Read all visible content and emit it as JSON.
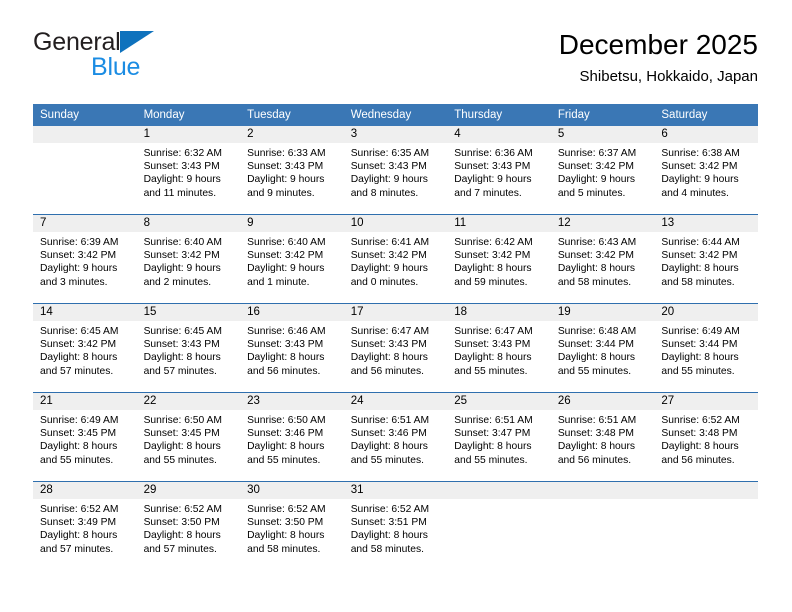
{
  "brand": {
    "name_part1": "General",
    "name_part2": "Blue",
    "triangle_color": "#0f72bd",
    "blue_text_color": "#1b8ce3"
  },
  "header": {
    "title": "December 2025",
    "subtitle": "Shibetsu, Hokkaido, Japan"
  },
  "theme": {
    "header_bg": "#3a77b5",
    "row_line": "#2f6fae",
    "daynum_band": "#efefef"
  },
  "calendar": {
    "weekday_headers": [
      "Sunday",
      "Monday",
      "Tuesday",
      "Wednesday",
      "Thursday",
      "Friday",
      "Saturday"
    ],
    "weeks": [
      [
        {
          "day": "",
          "sunrise": "",
          "sunset": "",
          "daylight_line1": "",
          "daylight_line2": ""
        },
        {
          "day": "1",
          "sunrise": "Sunrise: 6:32 AM",
          "sunset": "Sunset: 3:43 PM",
          "daylight_line1": "Daylight: 9 hours",
          "daylight_line2": "and 11 minutes."
        },
        {
          "day": "2",
          "sunrise": "Sunrise: 6:33 AM",
          "sunset": "Sunset: 3:43 PM",
          "daylight_line1": "Daylight: 9 hours",
          "daylight_line2": "and 9 minutes."
        },
        {
          "day": "3",
          "sunrise": "Sunrise: 6:35 AM",
          "sunset": "Sunset: 3:43 PM",
          "daylight_line1": "Daylight: 9 hours",
          "daylight_line2": "and 8 minutes."
        },
        {
          "day": "4",
          "sunrise": "Sunrise: 6:36 AM",
          "sunset": "Sunset: 3:43 PM",
          "daylight_line1": "Daylight: 9 hours",
          "daylight_line2": "and 7 minutes."
        },
        {
          "day": "5",
          "sunrise": "Sunrise: 6:37 AM",
          "sunset": "Sunset: 3:42 PM",
          "daylight_line1": "Daylight: 9 hours",
          "daylight_line2": "and 5 minutes."
        },
        {
          "day": "6",
          "sunrise": "Sunrise: 6:38 AM",
          "sunset": "Sunset: 3:42 PM",
          "daylight_line1": "Daylight: 9 hours",
          "daylight_line2": "and 4 minutes."
        }
      ],
      [
        {
          "day": "7",
          "sunrise": "Sunrise: 6:39 AM",
          "sunset": "Sunset: 3:42 PM",
          "daylight_line1": "Daylight: 9 hours",
          "daylight_line2": "and 3 minutes."
        },
        {
          "day": "8",
          "sunrise": "Sunrise: 6:40 AM",
          "sunset": "Sunset: 3:42 PM",
          "daylight_line1": "Daylight: 9 hours",
          "daylight_line2": "and 2 minutes."
        },
        {
          "day": "9",
          "sunrise": "Sunrise: 6:40 AM",
          "sunset": "Sunset: 3:42 PM",
          "daylight_line1": "Daylight: 9 hours",
          "daylight_line2": "and 1 minute."
        },
        {
          "day": "10",
          "sunrise": "Sunrise: 6:41 AM",
          "sunset": "Sunset: 3:42 PM",
          "daylight_line1": "Daylight: 9 hours",
          "daylight_line2": "and 0 minutes."
        },
        {
          "day": "11",
          "sunrise": "Sunrise: 6:42 AM",
          "sunset": "Sunset: 3:42 PM",
          "daylight_line1": "Daylight: 8 hours",
          "daylight_line2": "and 59 minutes."
        },
        {
          "day": "12",
          "sunrise": "Sunrise: 6:43 AM",
          "sunset": "Sunset: 3:42 PM",
          "daylight_line1": "Daylight: 8 hours",
          "daylight_line2": "and 58 minutes."
        },
        {
          "day": "13",
          "sunrise": "Sunrise: 6:44 AM",
          "sunset": "Sunset: 3:42 PM",
          "daylight_line1": "Daylight: 8 hours",
          "daylight_line2": "and 58 minutes."
        }
      ],
      [
        {
          "day": "14",
          "sunrise": "Sunrise: 6:45 AM",
          "sunset": "Sunset: 3:42 PM",
          "daylight_line1": "Daylight: 8 hours",
          "daylight_line2": "and 57 minutes."
        },
        {
          "day": "15",
          "sunrise": "Sunrise: 6:45 AM",
          "sunset": "Sunset: 3:43 PM",
          "daylight_line1": "Daylight: 8 hours",
          "daylight_line2": "and 57 minutes."
        },
        {
          "day": "16",
          "sunrise": "Sunrise: 6:46 AM",
          "sunset": "Sunset: 3:43 PM",
          "daylight_line1": "Daylight: 8 hours",
          "daylight_line2": "and 56 minutes."
        },
        {
          "day": "17",
          "sunrise": "Sunrise: 6:47 AM",
          "sunset": "Sunset: 3:43 PM",
          "daylight_line1": "Daylight: 8 hours",
          "daylight_line2": "and 56 minutes."
        },
        {
          "day": "18",
          "sunrise": "Sunrise: 6:47 AM",
          "sunset": "Sunset: 3:43 PM",
          "daylight_line1": "Daylight: 8 hours",
          "daylight_line2": "and 55 minutes."
        },
        {
          "day": "19",
          "sunrise": "Sunrise: 6:48 AM",
          "sunset": "Sunset: 3:44 PM",
          "daylight_line1": "Daylight: 8 hours",
          "daylight_line2": "and 55 minutes."
        },
        {
          "day": "20",
          "sunrise": "Sunrise: 6:49 AM",
          "sunset": "Sunset: 3:44 PM",
          "daylight_line1": "Daylight: 8 hours",
          "daylight_line2": "and 55 minutes."
        }
      ],
      [
        {
          "day": "21",
          "sunrise": "Sunrise: 6:49 AM",
          "sunset": "Sunset: 3:45 PM",
          "daylight_line1": "Daylight: 8 hours",
          "daylight_line2": "and 55 minutes."
        },
        {
          "day": "22",
          "sunrise": "Sunrise: 6:50 AM",
          "sunset": "Sunset: 3:45 PM",
          "daylight_line1": "Daylight: 8 hours",
          "daylight_line2": "and 55 minutes."
        },
        {
          "day": "23",
          "sunrise": "Sunrise: 6:50 AM",
          "sunset": "Sunset: 3:46 PM",
          "daylight_line1": "Daylight: 8 hours",
          "daylight_line2": "and 55 minutes."
        },
        {
          "day": "24",
          "sunrise": "Sunrise: 6:51 AM",
          "sunset": "Sunset: 3:46 PM",
          "daylight_line1": "Daylight: 8 hours",
          "daylight_line2": "and 55 minutes."
        },
        {
          "day": "25",
          "sunrise": "Sunrise: 6:51 AM",
          "sunset": "Sunset: 3:47 PM",
          "daylight_line1": "Daylight: 8 hours",
          "daylight_line2": "and 55 minutes."
        },
        {
          "day": "26",
          "sunrise": "Sunrise: 6:51 AM",
          "sunset": "Sunset: 3:48 PM",
          "daylight_line1": "Daylight: 8 hours",
          "daylight_line2": "and 56 minutes."
        },
        {
          "day": "27",
          "sunrise": "Sunrise: 6:52 AM",
          "sunset": "Sunset: 3:48 PM",
          "daylight_line1": "Daylight: 8 hours",
          "daylight_line2": "and 56 minutes."
        }
      ],
      [
        {
          "day": "28",
          "sunrise": "Sunrise: 6:52 AM",
          "sunset": "Sunset: 3:49 PM",
          "daylight_line1": "Daylight: 8 hours",
          "daylight_line2": "and 57 minutes."
        },
        {
          "day": "29",
          "sunrise": "Sunrise: 6:52 AM",
          "sunset": "Sunset: 3:50 PM",
          "daylight_line1": "Daylight: 8 hours",
          "daylight_line2": "and 57 minutes."
        },
        {
          "day": "30",
          "sunrise": "Sunrise: 6:52 AM",
          "sunset": "Sunset: 3:50 PM",
          "daylight_line1": "Daylight: 8 hours",
          "daylight_line2": "and 58 minutes."
        },
        {
          "day": "31",
          "sunrise": "Sunrise: 6:52 AM",
          "sunset": "Sunset: 3:51 PM",
          "daylight_line1": "Daylight: 8 hours",
          "daylight_line2": "and 58 minutes."
        },
        {
          "day": "",
          "sunrise": "",
          "sunset": "",
          "daylight_line1": "",
          "daylight_line2": ""
        },
        {
          "day": "",
          "sunrise": "",
          "sunset": "",
          "daylight_line1": "",
          "daylight_line2": ""
        },
        {
          "day": "",
          "sunrise": "",
          "sunset": "",
          "daylight_line1": "",
          "daylight_line2": ""
        }
      ]
    ]
  }
}
